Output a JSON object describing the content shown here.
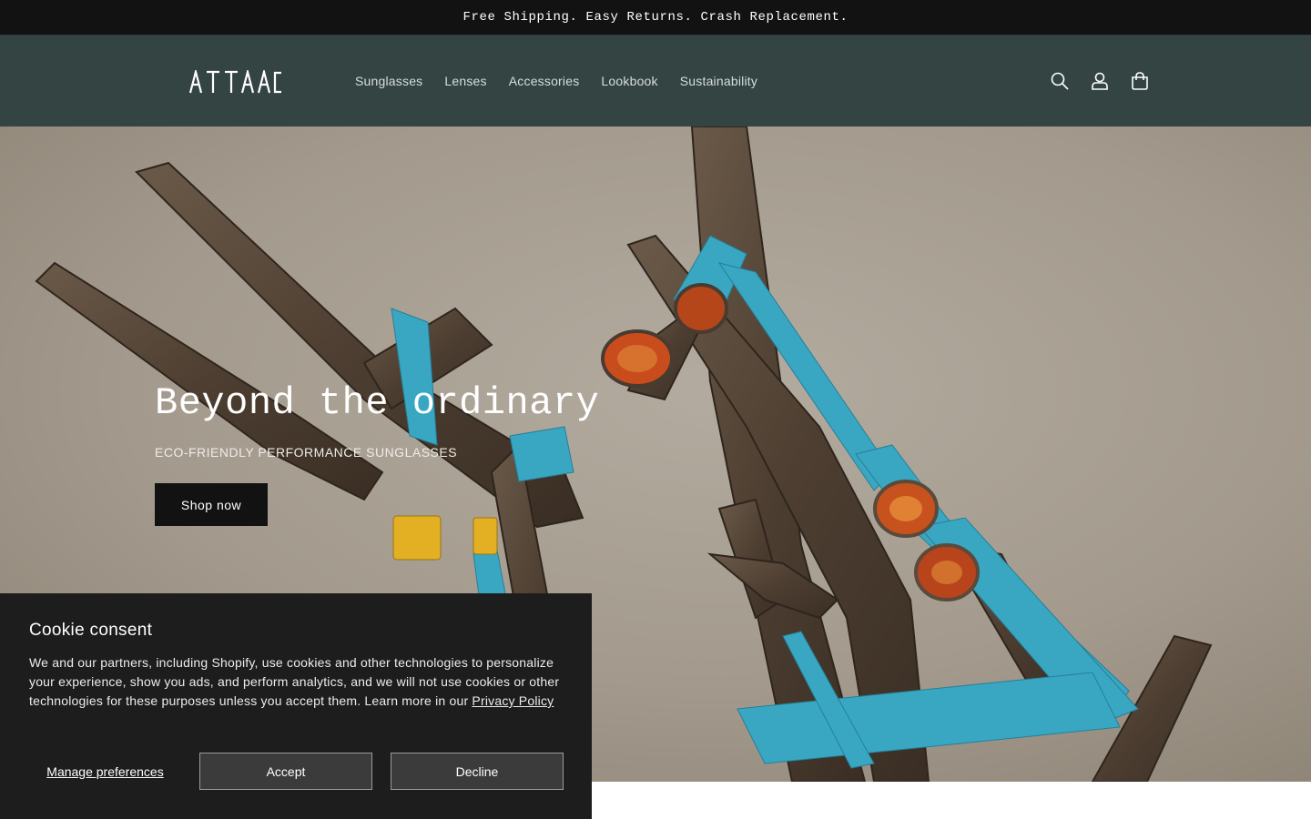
{
  "announcement": {
    "text": "Free Shipping. Easy Returns. Crash Replacement."
  },
  "header": {
    "logo_text": "ATTAAC",
    "nav": [
      {
        "label": "Sunglasses"
      },
      {
        "label": "Lenses"
      },
      {
        "label": "Accessories"
      },
      {
        "label": "Lookbook"
      },
      {
        "label": "Sustainability"
      }
    ],
    "icons": [
      "search-icon",
      "account-icon",
      "cart-icon"
    ]
  },
  "hero": {
    "title": "Beyond the ordinary",
    "subtitle": "ECO-FRIENDLY PERFORMANCE SUNGLASSES",
    "button_label": "Shop now"
  },
  "cookie": {
    "title": "Cookie consent",
    "body": "We and our partners, including Shopify, use cookies and other technologies to personalize your experience, show you ads, and perform analytics, and we will not use cookies or other technologies for these purposes unless you accept them. Learn more in our",
    "link_label": "Privacy Policy",
    "manage_label": "Manage preferences",
    "accept_label": "Accept",
    "decline_label": "Decline"
  },
  "colors": {
    "announcement_bg": "#121212",
    "header_bg": "#334443",
    "cookie_bg": "#1d1d1d",
    "button_bg": "#121212"
  }
}
